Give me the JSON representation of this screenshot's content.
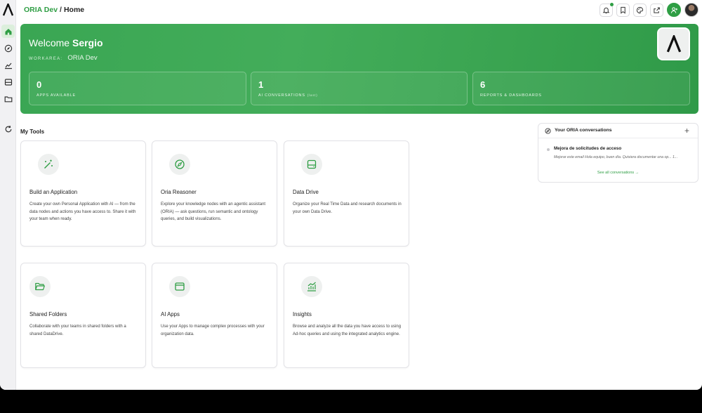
{
  "breadcrumb": {
    "workspace": "ORIA Dev",
    "separator": "/",
    "page": "Home"
  },
  "colors": {
    "accent": "#2f9e44",
    "hero_from": "#3aa653",
    "hero_to": "#2f9a48"
  },
  "top_actions": [
    "bell-icon",
    "bookmark-icon",
    "palette-icon",
    "share-icon",
    "add-user-icon",
    "avatar"
  ],
  "sidebar": [
    "home-icon",
    "compass-icon",
    "chart-icon",
    "drive-icon",
    "folder-icon",
    "refresh-icon"
  ],
  "hero": {
    "greeting": "Welcome",
    "user": "Sergio",
    "workarea_label": "WORKAREA:",
    "workarea": "ORIA Dev",
    "stats": [
      {
        "value": "0",
        "label": "APPS AVAILABLE",
        "sub": ""
      },
      {
        "value": "1",
        "label": "AI CONVERSATIONS",
        "sub": "(last)"
      },
      {
        "value": "6",
        "label": "REPORTS & DASHBOARDS",
        "sub": ""
      }
    ]
  },
  "tools": {
    "title": "My Tools",
    "cards": [
      {
        "icon": "magic-wand-icon",
        "title": "Build an Application",
        "desc": "Create your own Personal Application with AI — from the data nodes and actions you have access to. Share it with your team when ready."
      },
      {
        "icon": "compass-icon",
        "title": "Oria Reasoner",
        "desc": "Explore your knowledge nodes with an agentic assistant (ORIA) — ask questions, run semantic and ontology queries, and build visualizations."
      },
      {
        "icon": "drive-icon",
        "title": "Data Drive",
        "desc": "Organize your Real Time Data and research documents in your own Data Drive."
      },
      {
        "icon": "folder-open-icon",
        "title": "Shared Folders",
        "desc": "Collaborate with your teams in shared folders with a shared DataDrive."
      },
      {
        "icon": "browser-window-icon",
        "title": "AI Apps",
        "desc": "Use your Apps to manage complex processes with your organization data."
      },
      {
        "icon": "bar-chart-icon",
        "title": "Insights",
        "desc": "Browse and analyze all the data you have access to using Ad-hoc queries and using the integrated analytics engine."
      }
    ]
  },
  "conversations": {
    "title": "Your ORIA conversations",
    "add_label": "+",
    "items": [
      {
        "title": "Mejora de solicitudes de acceso",
        "preview": "Mejorar este email Hola equipo, buen día. Quisiera documentar una op... 1..."
      }
    ],
    "see_all": "See all conversations →"
  }
}
